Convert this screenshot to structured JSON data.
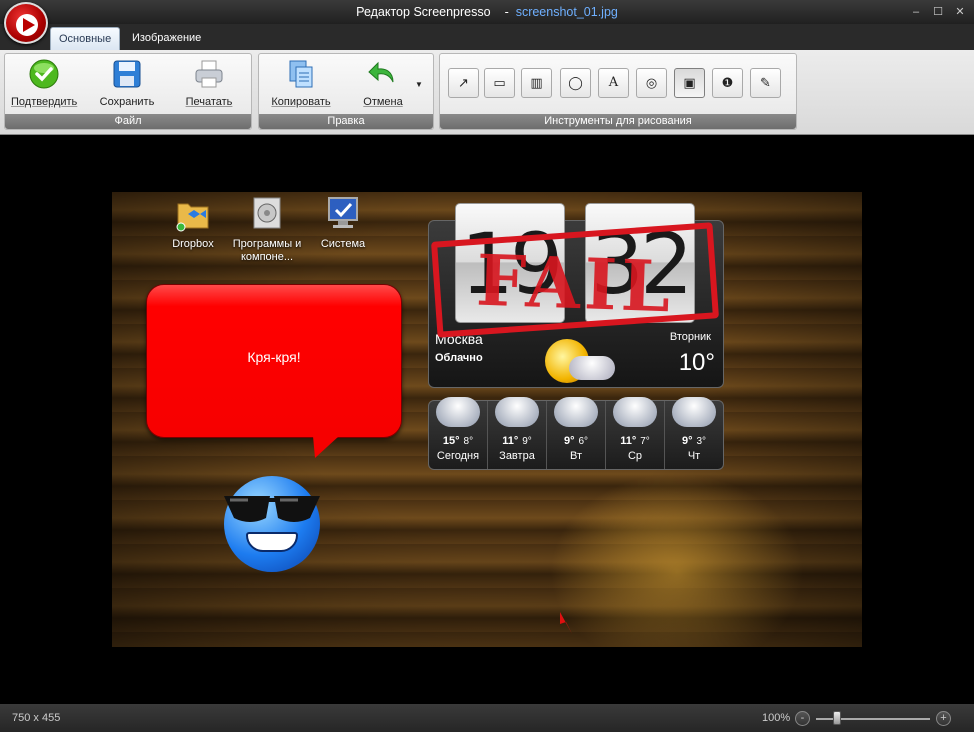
{
  "window": {
    "title": "Редактор Screenpresso",
    "filename": "screenshot_01.jpg",
    "controls": {
      "minimize": "–",
      "maximize": "☐",
      "close": "✕"
    }
  },
  "tabs": [
    {
      "label": "Основные",
      "active": true
    },
    {
      "label": "Изображение",
      "active": false
    }
  ],
  "ribbon": {
    "file_group": {
      "label": "Файл",
      "buttons": [
        {
          "label": "Подтвердить",
          "icon": "confirm-check-icon"
        },
        {
          "label": "Сохранить",
          "icon": "floppy-disk-icon"
        },
        {
          "label": "Печатать",
          "icon": "printer-icon"
        }
      ]
    },
    "edit_group": {
      "label": "Правка",
      "buttons": [
        {
          "label": "Копировать",
          "icon": "copy-icon"
        },
        {
          "label": "Отмена",
          "icon": "undo-icon"
        }
      ]
    },
    "draw_group": {
      "label": "Инструменты для рисования",
      "tools": [
        {
          "icon": "arrow-tool-icon",
          "glyph": "↗"
        },
        {
          "icon": "rectangle-tool-icon",
          "glyph": "▭"
        },
        {
          "icon": "highlight-tool-icon",
          "glyph": "▥"
        },
        {
          "icon": "ellipse-tool-icon",
          "glyph": "◯"
        },
        {
          "icon": "text-tool-icon",
          "glyph": "A"
        },
        {
          "icon": "callout-tool-icon",
          "glyph": "◎"
        },
        {
          "icon": "image-tool-icon",
          "glyph": "▣",
          "selected": true
        },
        {
          "icon": "step-number-tool-icon",
          "glyph": "❶"
        },
        {
          "icon": "blur-tool-icon",
          "glyph": "✎"
        }
      ]
    }
  },
  "canvas": {
    "desktop_icons": [
      {
        "label": "Dropbox",
        "icon": "dropbox-folder-icon"
      },
      {
        "label": "Программы и компоне...",
        "icon": "programs-icon"
      },
      {
        "label": "Система",
        "icon": "computer-icon"
      }
    ],
    "clock": {
      "hours": "19",
      "minutes": "32"
    },
    "weather": {
      "city": "Москва",
      "condition": "Облачно",
      "temperature": "10°",
      "right_text": "Вторник"
    },
    "forecast": [
      {
        "high": "15°",
        "low": "8°",
        "day": "Сегодня"
      },
      {
        "high": "11°",
        "low": "9°",
        "day": "Завтра"
      },
      {
        "high": "9°",
        "low": "6°",
        "day": "Вт"
      },
      {
        "high": "11°",
        "low": "7°",
        "day": "Ср"
      },
      {
        "high": "9°",
        "low": "3°",
        "day": "Чт"
      }
    ],
    "stamp_text": "FAIL",
    "bubble_text": "Кря-кря!"
  },
  "status": {
    "image_size": "750 x 455",
    "zoom": "100%",
    "zoom_out": "-",
    "zoom_in": "+"
  },
  "colors": {
    "stamp": "#d8161f",
    "bubble": "#ff0000",
    "file_link": "#6fb0ff"
  }
}
